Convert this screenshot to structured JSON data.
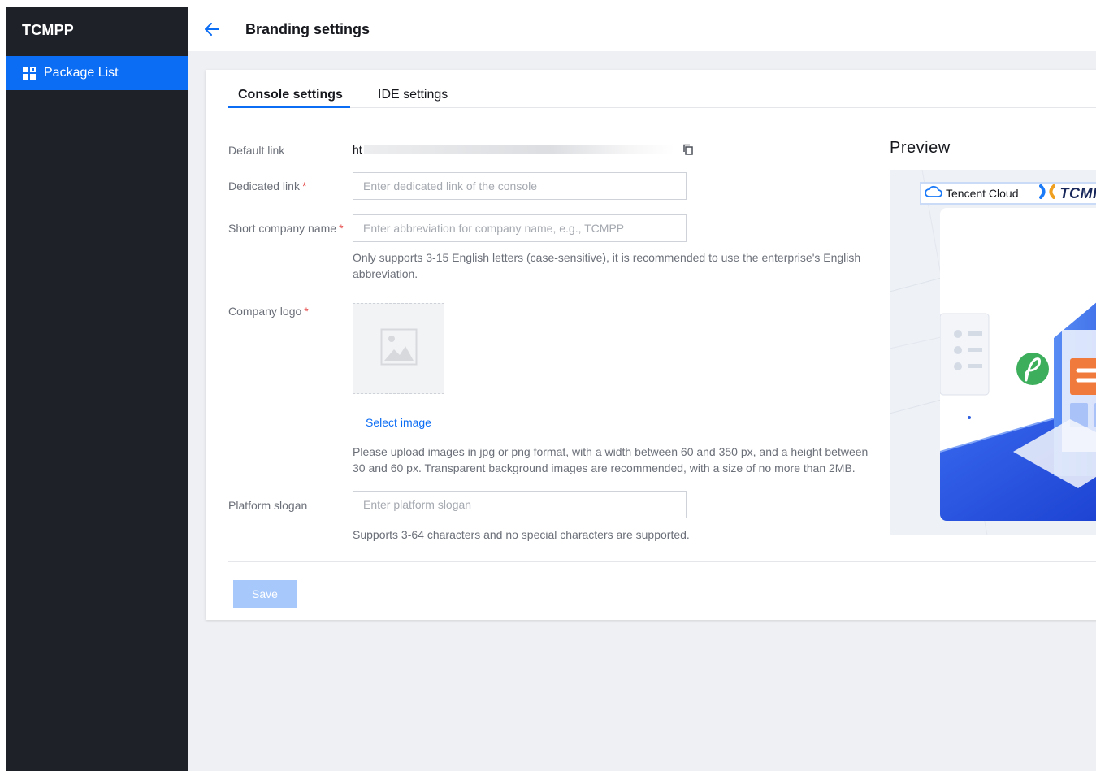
{
  "app": {
    "name": "TCMPP"
  },
  "sidebar": {
    "items": [
      {
        "label": "Package List",
        "icon": "grid-icon",
        "active": true
      }
    ]
  },
  "header": {
    "title": "Branding settings",
    "back_icon": "arrow-left-icon"
  },
  "tabs": [
    {
      "label": "Console settings",
      "active": true
    },
    {
      "label": "IDE settings",
      "active": false
    }
  ],
  "form": {
    "default_link": {
      "label": "Default link",
      "value_prefix": "ht"
    },
    "dedicated_link": {
      "label": "Dedicated link",
      "placeholder": "Enter dedicated link of the console",
      "value": ""
    },
    "short_company_name": {
      "label": "Short company name",
      "placeholder": "Enter abbreviation for company name, e.g., TCMPP",
      "value": "",
      "hint": "Only supports 3-15 English letters (case-sensitive), it is recommended to use the enterprise's English abbreviation."
    },
    "company_logo": {
      "label": "Company logo",
      "button": "Select image",
      "hint": "Please upload images in jpg or png format, with a width between 60 and 350 px, and a height between 30 and 60 px. Transparent background images are recommended, with a size of no more than 2MB."
    },
    "platform_slogan": {
      "label": "Platform slogan",
      "placeholder": "Enter platform slogan",
      "value": "",
      "hint": "Supports 3-64 characters and no special characters are supported."
    },
    "required_mark": "*",
    "save_button": "Save"
  },
  "preview": {
    "title": "Preview",
    "brand_text": "Tencent Cloud",
    "product_text": "TCMI"
  },
  "colors": {
    "primary": "#0b6cf4",
    "sidebar_bg": "#1f2129",
    "required": "#e54545",
    "disabled_button": "#a6c8fb"
  }
}
